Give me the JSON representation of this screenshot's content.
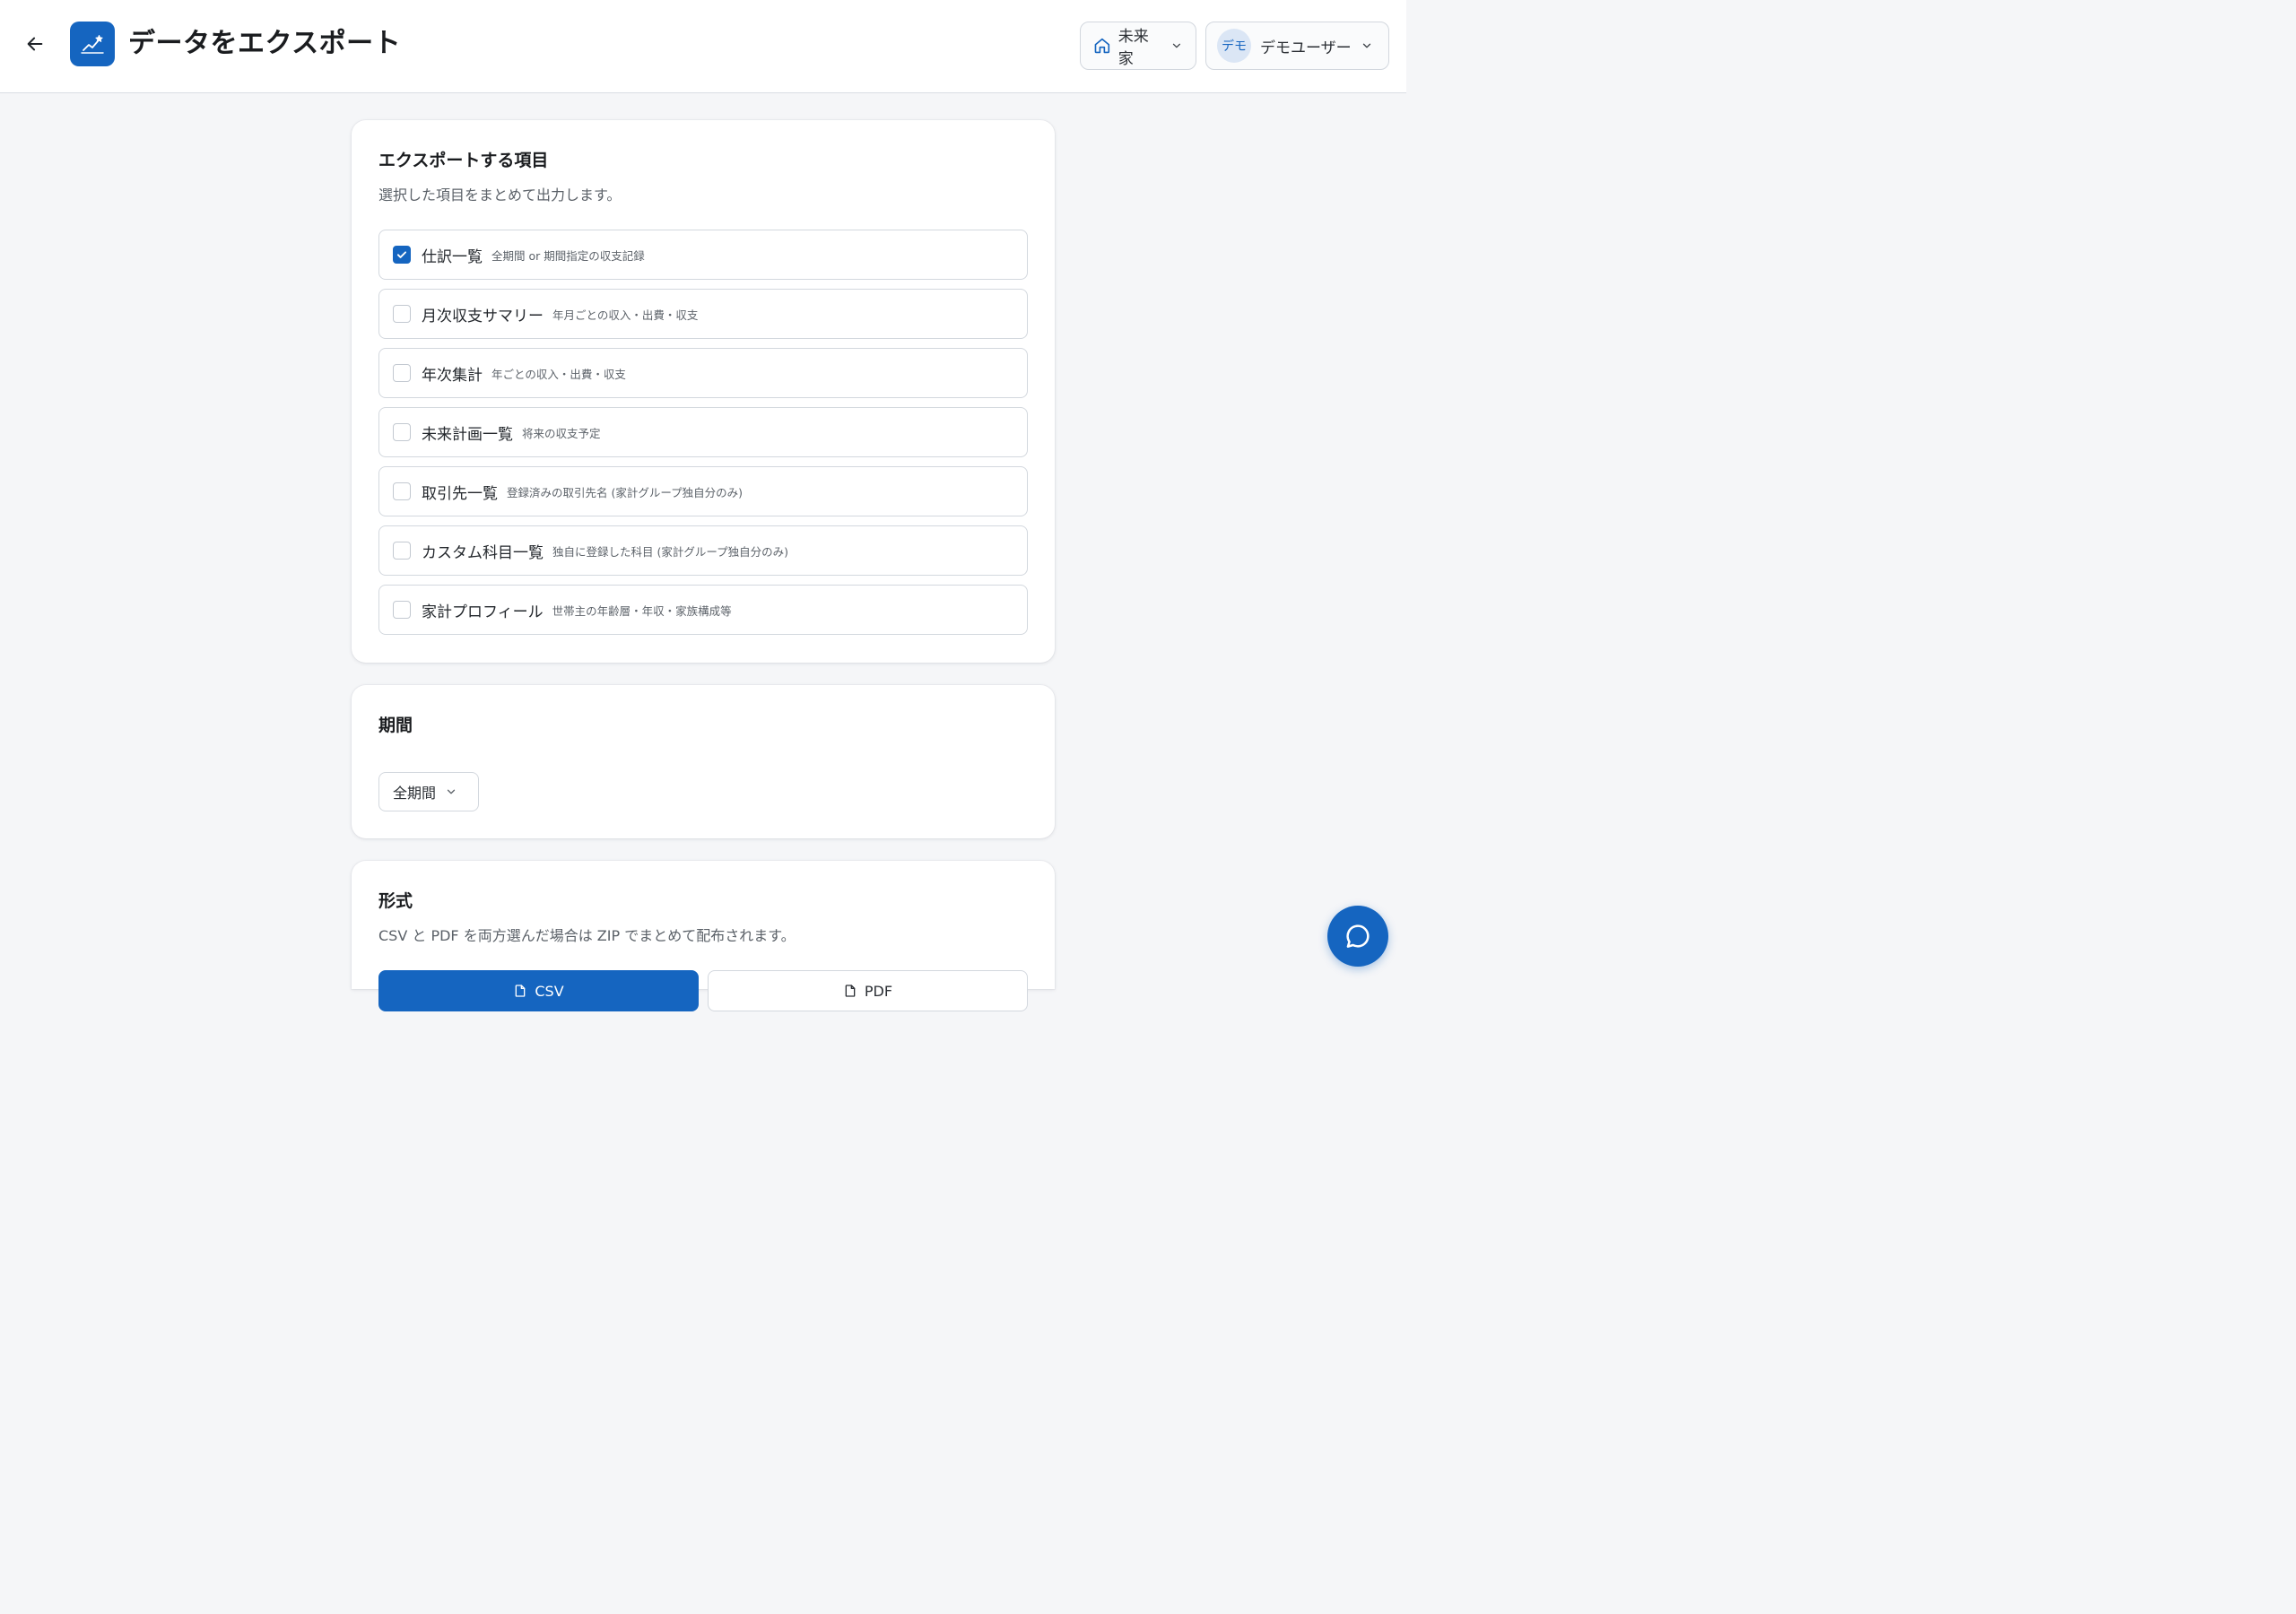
{
  "header": {
    "title": "データをエクスポート",
    "household_label": "未来家",
    "user_avatar_text": "デモ",
    "user_name": "デモユーザー"
  },
  "items_section": {
    "title": "エクスポートする項目",
    "description": "選択した項目をまとめて出力します。",
    "items": [
      {
        "label": "仕訳一覧",
        "desc": "全期間 or 期間指定の収支記録",
        "checked": true
      },
      {
        "label": "月次収支サマリー",
        "desc": "年月ごとの収入・出費・収支",
        "checked": false
      },
      {
        "label": "年次集計",
        "desc": "年ごとの収入・出費・収支",
        "checked": false
      },
      {
        "label": "未来計画一覧",
        "desc": "将来の収支予定",
        "checked": false
      },
      {
        "label": "取引先一覧",
        "desc": "登録済みの取引先名 (家計グループ独自分のみ)",
        "checked": false
      },
      {
        "label": "カスタム科目一覧",
        "desc": "独自に登録した科目 (家計グループ独自分のみ)",
        "checked": false
      },
      {
        "label": "家計プロフィール",
        "desc": "世帯主の年齢層・年収・家族構成等",
        "checked": false
      }
    ]
  },
  "period_section": {
    "title": "期間",
    "selected": "全期間"
  },
  "format_section": {
    "title": "形式",
    "description": "CSV と PDF を両方選んだ場合は ZIP でまとめて配布されます。",
    "csv_label": "CSV",
    "pdf_label": "PDF",
    "csv_selected": true,
    "pdf_selected": false
  },
  "colors": {
    "accent": "#1565c0",
    "background": "#f5f6f8"
  }
}
